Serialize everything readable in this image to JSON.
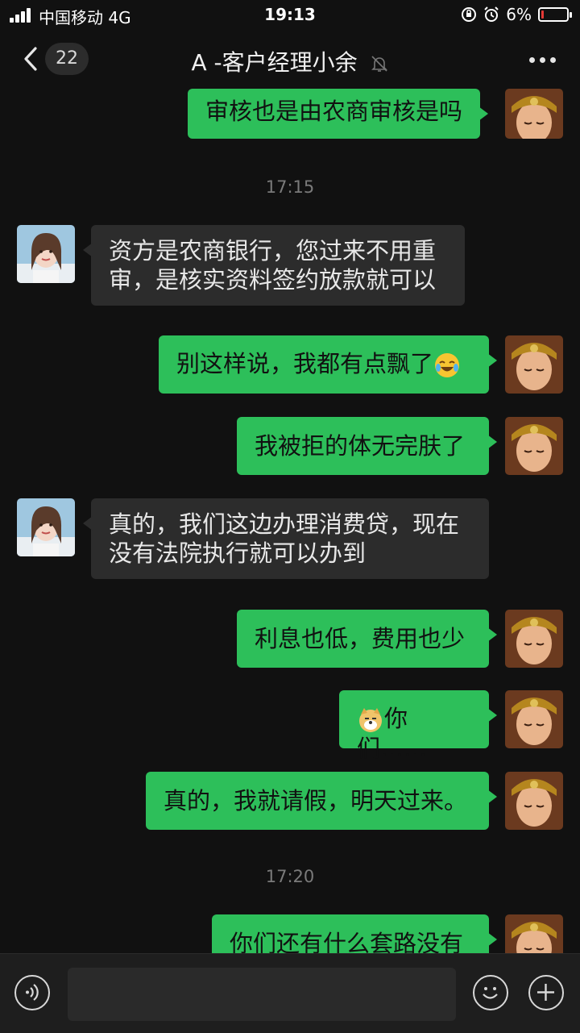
{
  "status_bar": {
    "carrier": "中国移动  4G",
    "time": "19:13",
    "battery": "6%",
    "icons": [
      "signal-icon",
      "rotation-lock-icon",
      "alarm-icon",
      "battery-icon"
    ]
  },
  "header": {
    "back_count": "22",
    "title": "A -客户经理小余",
    "icons": [
      "back-chevron-icon",
      "mute-bell-icon",
      "more-dots-icon"
    ]
  },
  "colors": {
    "background": "#111111",
    "my_bubble": "#2dbf5a",
    "their_bubble": "#2c2c2c"
  },
  "messages": [
    {
      "side": "me",
      "text": "审核也是由农商审核是吗"
    },
    {
      "side": "time",
      "text": "17:15"
    },
    {
      "side": "them",
      "text": "资方是农商银行，您过来不用重审，是核实资料签约放款就可以"
    },
    {
      "side": "me",
      "text": "别这样说，我都有点飘了",
      "emoji": "laughing-crying-emoji"
    },
    {
      "side": "me",
      "text": "我被拒的体无完肤了"
    },
    {
      "side": "them",
      "text": "真的，我们这边办理消费贷，现在没有法院执行就可以办到"
    },
    {
      "side": "me",
      "text": "利息也低，费用也少"
    },
    {
      "side": "me",
      "text": "你们……",
      "emoji": "doge-emoji"
    },
    {
      "side": "me",
      "text": "真的，我就请假，明天过来。"
    },
    {
      "side": "time",
      "text": "17:20"
    },
    {
      "side": "me",
      "text": "你们还有什么套路没有"
    }
  ],
  "input_bar": {
    "placeholder": "",
    "icons": [
      "voice-icon",
      "emoji-icon",
      "plus-icon"
    ]
  }
}
